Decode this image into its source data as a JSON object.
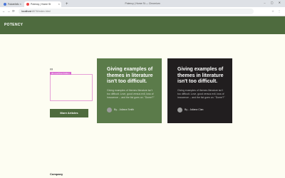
{
  "browser": {
    "tabs": [
      {
        "label": "FutureInfo"
      },
      {
        "label": "Potency | Home St"
      }
    ],
    "new_tab": "+",
    "window_title": "Potency | Home St — Chromium",
    "address": {
      "host": "localhost",
      "path": ":8076/index.html"
    },
    "nav": {
      "back": "←",
      "forward": "→",
      "reload": "⟳"
    },
    "window_controls": "– ▢ ✕"
  },
  "site": {
    "logo": "POTENCY",
    "infinity": "∞",
    "selection_label": "div.overflow-hidden",
    "more_button": "More Articles",
    "cards": [
      {
        "title": "Giving examples of themes in literature isn't too difficult.",
        "body": "Giving examples of themes literature isn't too difficult. Love, good versus evil, loss of innocence -- and the list goes on. \"Dome\"!\"",
        "author": "By - Juliana Smith"
      },
      {
        "title": "Giving examples of themes in literature isn't too difficult.",
        "body": "Giving examples of themes literature isn't too difficult. Love, good versus evil, loss of innocence -- and the list goes on. \"Dome\"!\"",
        "author": "By - Juliana Clan"
      }
    ],
    "footer_heading": "Company"
  },
  "colors": {
    "brand_green": "#4e6b3e",
    "card_green": "#5b7b4a",
    "card_dark": "#211e1f",
    "page_bg": "#fdfdf2",
    "selection": "#d96ad0"
  }
}
